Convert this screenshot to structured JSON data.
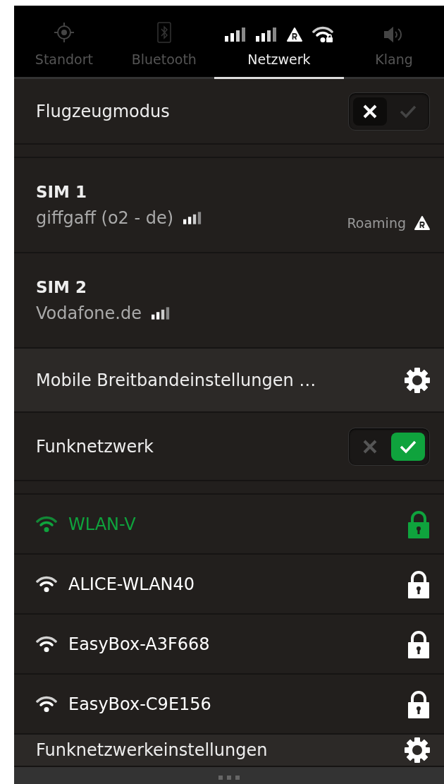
{
  "tabs": [
    {
      "label": "Standort",
      "selected": false
    },
    {
      "label": "Bluetooth",
      "selected": false
    },
    {
      "label": "Netzwerk",
      "selected": true
    },
    {
      "label": "Klang",
      "selected": false
    }
  ],
  "airplane_mode": {
    "label": "Flugzeugmodus",
    "on": false
  },
  "sims": [
    {
      "name": "SIM 1",
      "operator": "giffgaff (o2 - de)",
      "roaming": "Roaming"
    },
    {
      "name": "SIM 2",
      "operator": "Vodafone.de"
    }
  ],
  "mobile_settings": {
    "label": "Mobile Breitbandeinstellungen …"
  },
  "wifi": {
    "label": "Funknetzwerk",
    "on": true
  },
  "networks": [
    {
      "name": "WLAN-V",
      "selected": true
    },
    {
      "name": "ALICE-WLAN40",
      "selected": false
    },
    {
      "name": "EasyBox-A3F668",
      "selected": false
    },
    {
      "name": "EasyBox-C9E156",
      "selected": false
    }
  ],
  "wifi_settings": {
    "label": "Funknetzwerkeinstellungen"
  }
}
